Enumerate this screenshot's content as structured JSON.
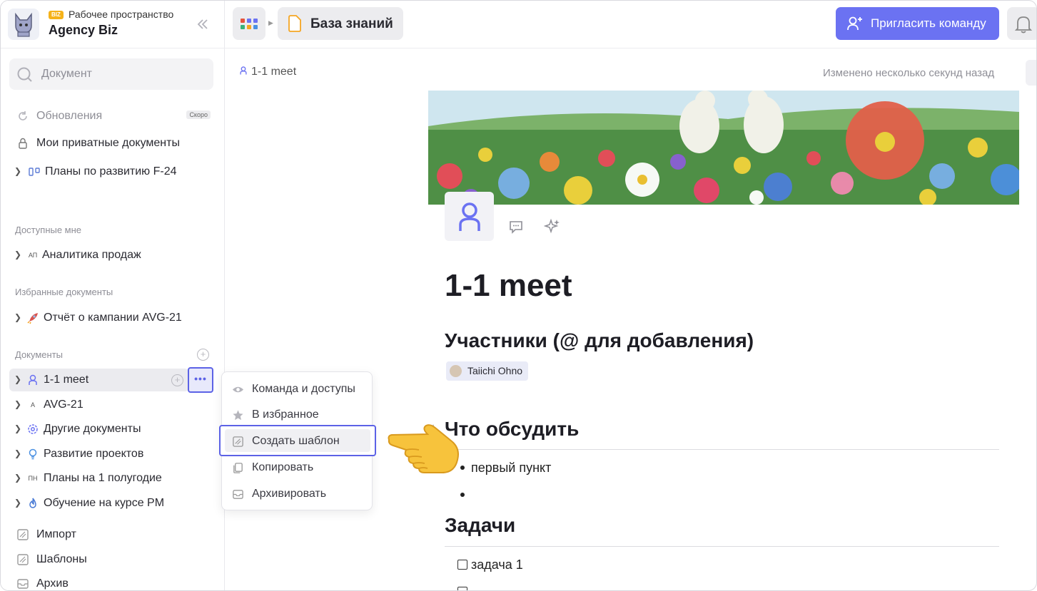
{
  "workspace": {
    "badge": "BIZ",
    "label": "Рабочее пространство",
    "name": "Agency Biz"
  },
  "search": {
    "placeholder": "Документ"
  },
  "sidebar": {
    "top_items": [
      {
        "label": "Обновления",
        "icon": "refresh-icon",
        "badge": "Скоро"
      },
      {
        "label": "Мои приватные документы",
        "icon": "lock-icon"
      },
      {
        "label": "Планы по развитию F-24",
        "icon": "roadmap-icon"
      }
    ],
    "section_shared": "Доступные мне",
    "shared_items": [
      {
        "label": "Аналитика продаж",
        "icon_text": "АП"
      }
    ],
    "section_favorites": "Избранные документы",
    "favorite_items": [
      {
        "label": "Отчёт о кампании AVG-21",
        "icon": "rocket-icon"
      }
    ],
    "section_docs": "Документы",
    "doc_items": [
      {
        "label": "1-1 meet",
        "icon": "person-icon",
        "active": true
      },
      {
        "label": "AVG-21",
        "icon_text": "A"
      },
      {
        "label": "Другие документы",
        "icon": "gear-icon"
      },
      {
        "label": "Развитие проектов",
        "icon": "bulb-icon"
      },
      {
        "label": "Планы на 1 полугодие",
        "icon_text": "ПН"
      },
      {
        "label": "Обучение на курсе PM",
        "icon": "flame-icon"
      }
    ],
    "bottom_items": [
      {
        "label": "Импорт",
        "icon": "import-icon"
      },
      {
        "label": "Шаблоны",
        "icon": "template-icon"
      },
      {
        "label": "Архив",
        "icon": "archive-icon"
      }
    ]
  },
  "topbar": {
    "breadcrumb": "База знаний",
    "invite_label": "Пригласить команду"
  },
  "document": {
    "breadcrumb": "1-1 meet",
    "modified": "Изменено несколько секунд назад",
    "title": "1-1 meet",
    "participants_heading": "Участники (@ для добавления)",
    "participant": "Taiichi Ohno",
    "discuss_heading": "Что обсудить",
    "bullets": [
      "первый пункт",
      ""
    ],
    "tasks_heading": "Задачи",
    "tasks": [
      "задача 1",
      ""
    ]
  },
  "context_menu": {
    "items": [
      {
        "label": "Команда и доступы",
        "icon": "eye-icon"
      },
      {
        "label": "В избранное",
        "icon": "star-icon"
      },
      {
        "label": "Создать шаблон",
        "icon": "template-icon",
        "highlighted": true
      },
      {
        "label": "Копировать",
        "icon": "copy-icon"
      },
      {
        "label": "Архивировать",
        "icon": "archive-icon"
      }
    ]
  },
  "colors": {
    "accent": "#6b72f2",
    "highlight_border": "#5c62e6",
    "badge": "#f5b21a"
  }
}
